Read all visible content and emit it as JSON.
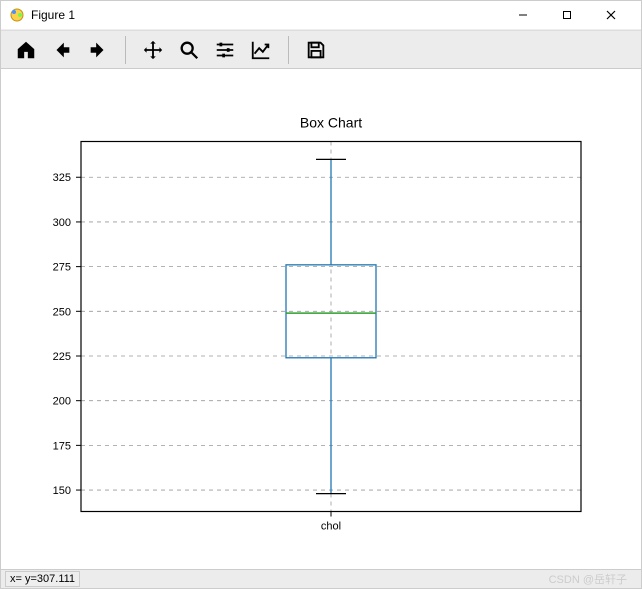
{
  "window": {
    "title": "Figure 1"
  },
  "toolbar": {
    "home": "home",
    "back": "back",
    "forward": "forward",
    "pan": "pan",
    "zoom": "zoom",
    "subplots": "subplots",
    "axis": "axis",
    "save": "save"
  },
  "status": {
    "coords": "x= y=307.111",
    "watermark": "CSDN @岳轩子"
  },
  "chart_data": {
    "type": "boxplot",
    "title": "Box Chart",
    "xticklabels": [
      "chol"
    ],
    "yticks": [
      150,
      175,
      200,
      225,
      250,
      275,
      300,
      325
    ],
    "ylim": [
      138,
      345
    ],
    "series": [
      {
        "name": "chol",
        "q1": 224,
        "median": 249,
        "q3": 276,
        "whisker_low": 148,
        "whisker_high": 335
      }
    ],
    "colors": {
      "box_border": "#1f77b4",
      "median": "#2ca02c",
      "whisker": "#1f77b4",
      "cap": "#000000"
    }
  }
}
